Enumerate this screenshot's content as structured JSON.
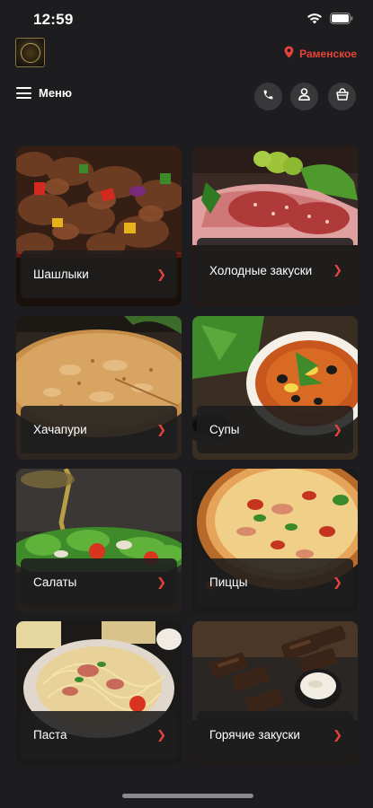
{
  "status": {
    "time": "12:59"
  },
  "header": {
    "location": "Раменское",
    "menu_label": "Меню"
  },
  "icons": {
    "location": "map-pin-icon",
    "menu": "hamburger-icon",
    "phone": "phone-icon",
    "profile": "user-icon",
    "cart": "basket-icon",
    "chevron": "chevron-right-icon"
  },
  "colors": {
    "accent": "#e8433a",
    "background": "#1d1d1f",
    "button": "#38383a"
  },
  "categories": [
    {
      "label": "Шашлыки"
    },
    {
      "label": "Холодные закуски"
    },
    {
      "label": "Хачапури"
    },
    {
      "label": "Супы"
    },
    {
      "label": "Салаты"
    },
    {
      "label": "Пиццы"
    },
    {
      "label": "Паста"
    },
    {
      "label": "Горячие закуски"
    }
  ]
}
